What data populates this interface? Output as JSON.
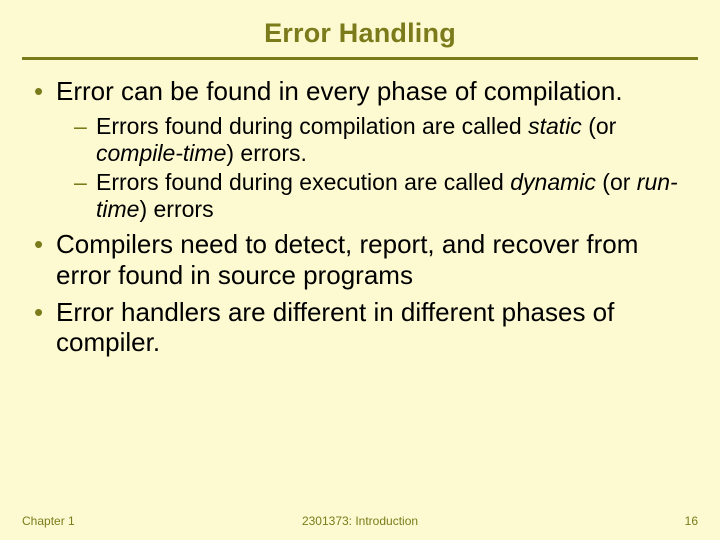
{
  "title": "Error Handling",
  "bullets": {
    "b1": "Error can be found in every phase of compilation.",
    "s1a_pre": "Errors found during compilation are called ",
    "s1a_em1": "static",
    "s1a_mid": " (or ",
    "s1a_em2": "compile-time",
    "s1a_post": ") errors.",
    "s1b_pre": "Errors found during execution are called ",
    "s1b_em1": "dynamic",
    "s1b_mid": " (or ",
    "s1b_em2": "run-time",
    "s1b_post": ") errors",
    "b2": "Compilers need to detect, report, and recover from error found in source programs",
    "b3": "Error handlers are different in different phases of compiler."
  },
  "footer": {
    "left": "Chapter 1",
    "center": "2301373: Introduction",
    "right": "16"
  }
}
